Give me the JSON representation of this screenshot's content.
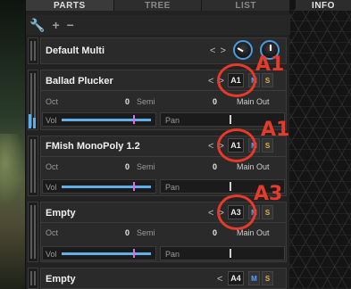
{
  "tabs": [
    {
      "label": "PARTS",
      "active": true
    },
    {
      "label": "TREE",
      "active": false
    },
    {
      "label": "LIST",
      "active": false
    },
    {
      "label": "INFO",
      "active": false
    }
  ],
  "toolbar": {
    "icons": [
      "wrench-icon",
      "plus-icon",
      "minus-icon"
    ]
  },
  "multi": {
    "name": "Default Multi",
    "nav": "< >"
  },
  "parts": [
    {
      "name": "Ballad Plucker",
      "nav": "< >",
      "channel": "A1",
      "mute": "M",
      "solo": "S",
      "oct_label": "Oct",
      "oct": "0",
      "semi_label": "Semi",
      "semi": "0",
      "output": "Main Out",
      "vol_label": "Vol",
      "vol_level": 0.82,
      "pan_label": "Pan",
      "pan_level": 0.5
    },
    {
      "name": "FMish MonoPoly 1.2",
      "nav": "< >",
      "channel": "A1",
      "mute": "M",
      "solo": "S",
      "oct_label": "Oct",
      "oct": "0",
      "semi_label": "Semi",
      "semi": "0",
      "output": "Main Out",
      "vol_label": "Vol",
      "vol_level": 0.82,
      "pan_label": "Pan",
      "pan_level": 0.5
    },
    {
      "name": "Empty",
      "nav": "< >",
      "channel": "A3",
      "mute": "M",
      "solo": "S",
      "oct_label": "Oct",
      "oct": "0",
      "semi_label": "Semi",
      "semi": "0",
      "output": "Main Out",
      "vol_label": "Vol",
      "vol_level": 0.82,
      "pan_label": "Pan",
      "pan_level": 0.5
    },
    {
      "name": "Empty",
      "nav": "<",
      "channel": "A4",
      "mute": "M",
      "solo": "S"
    }
  ],
  "annotations": [
    "A1",
    "A1",
    "A3"
  ],
  "colors": {
    "annotation": "#e63a2a",
    "accent": "#4b9be0",
    "mute": "#5aa0ff",
    "solo": "#e3b04b"
  }
}
